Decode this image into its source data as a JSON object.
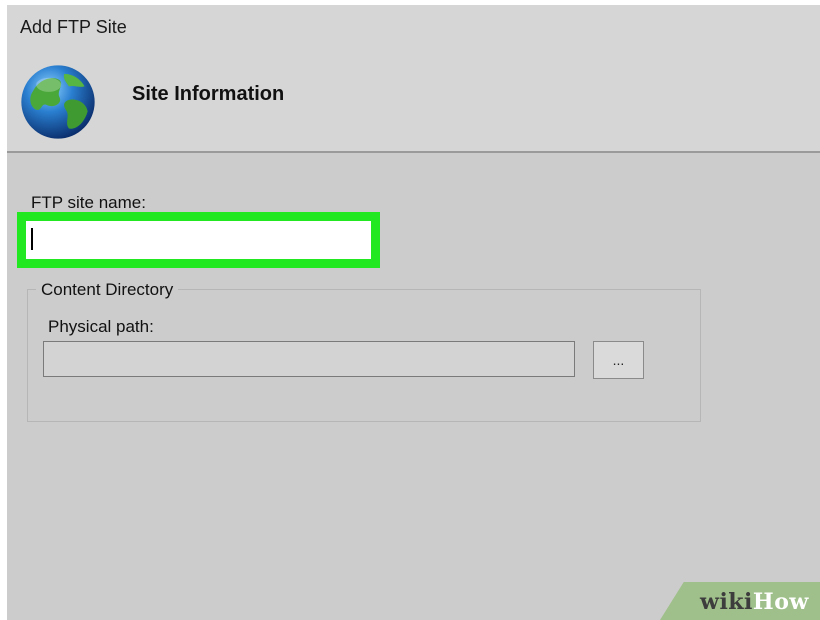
{
  "window": {
    "title": "Add FTP Site"
  },
  "header": {
    "heading": "Site Information",
    "icon": "globe-icon"
  },
  "form": {
    "site_name_label": "FTP site name:",
    "site_name_value": "",
    "content_group_label": "Content Directory",
    "physical_path_label": "Physical path:",
    "physical_path_value": "",
    "browse_label": "..."
  },
  "colors": {
    "highlight": "#21e821",
    "background": "#cccccc"
  },
  "watermark": {
    "part1": "wiki",
    "part2": "How"
  }
}
